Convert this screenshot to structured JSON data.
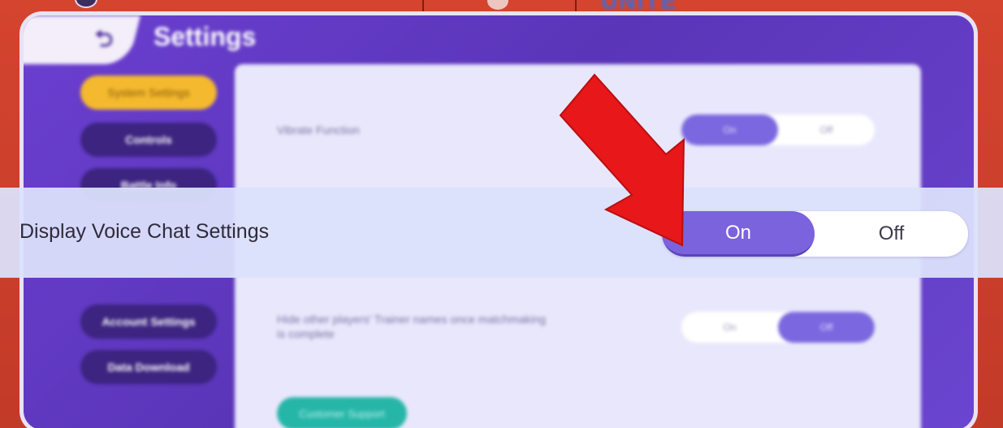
{
  "header": {
    "title": "Settings",
    "back_icon": "back-arrow-icon"
  },
  "side_nav": {
    "items": [
      {
        "label": "System Settings",
        "active": true
      },
      {
        "label": "Controls",
        "active": false
      },
      {
        "label": "Battle Info",
        "active": false
      },
      {
        "label": "Account Settings",
        "active": false
      },
      {
        "label": "Data Download",
        "active": false
      }
    ]
  },
  "content": {
    "rows": [
      {
        "label": "Vibrate Function",
        "on_label": "On",
        "off_label": "Off",
        "selected": "On"
      },
      {
        "label": "Hide other players' Trainer names once matchmaking is complete",
        "on_label": "On",
        "off_label": "Off",
        "selected": "Off"
      }
    ],
    "support_button": "Customer Support"
  },
  "zoom": {
    "label": "Display Voice Chat Settings",
    "on_label": "On",
    "off_label": "Off",
    "selected": "On"
  },
  "annotation": {
    "arrow_color": "#e8171a",
    "arrow_icon": "red-arrow-icon"
  },
  "colors": {
    "frame": "#c9412f",
    "panel": "#6b3fd1",
    "nav_active": "#f4b92e",
    "toggle_on": "#7a63dc",
    "support": "#26b6a8"
  }
}
